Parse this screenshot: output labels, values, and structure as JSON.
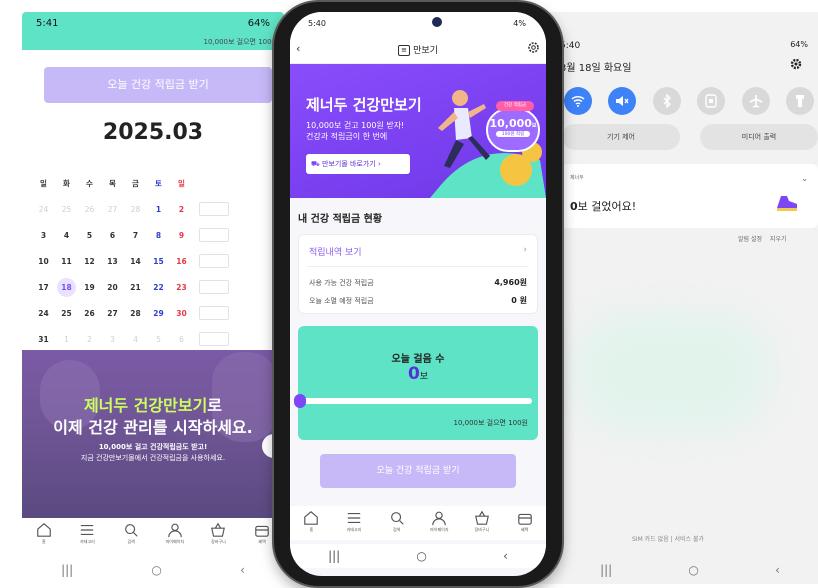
{
  "left": {
    "status_time": "5:41",
    "status_right": "64%",
    "banner_text": "10,000보 걸으면 100원",
    "redeem_label": "오늘 건강 적립금 받기",
    "month": "2025.03",
    "weekdays": [
      "일",
      "화",
      "수",
      "목",
      "금",
      "토",
      "일"
    ],
    "weeks": [
      [
        "24",
        "25",
        "26",
        "27",
        "28",
        "1",
        "2"
      ],
      [
        "3",
        "4",
        "5",
        "6",
        "7",
        "8",
        "9"
      ],
      [
        "10",
        "11",
        "12",
        "13",
        "14",
        "15",
        "16"
      ],
      [
        "17",
        "18",
        "19",
        "20",
        "21",
        "22",
        "23"
      ],
      [
        "24",
        "25",
        "26",
        "27",
        "28",
        "29",
        "30"
      ],
      [
        "31",
        "1",
        "2",
        "3",
        "4",
        "5",
        "6"
      ]
    ],
    "promo_title_accent": "제너두 건강만보기",
    "promo_title_rest": "로",
    "promo_title_line2": "이제 건강 관리를 시작하세요.",
    "promo_sub1": "10,000보 걸고 건강적립금도 받고!",
    "promo_sub2": "지금 건강만보기몰에서 건강적립금을 사용하세요.",
    "promo_button": "›",
    "nav": [
      {
        "icon": "home-icon",
        "label": "홈"
      },
      {
        "icon": "menu-icon",
        "label": "카테고리"
      },
      {
        "icon": "search-icon",
        "label": "검색"
      },
      {
        "icon": "person-icon",
        "label": "마이페이지"
      },
      {
        "icon": "basket-icon",
        "label": "장바구니"
      },
      {
        "icon": "box-icon",
        "label": "혜택"
      }
    ],
    "sys": [
      "|||",
      "○",
      "‹"
    ]
  },
  "phone": {
    "status_time": "5:40",
    "status_right": "4%",
    "header_title": "만보기",
    "hero_title": "제너두 건강만보기",
    "hero_sub1": "10,000보 걷고 100원 받자!",
    "hero_sub2": "건강과 적립금이 한 번에",
    "hero_button": "만보기몰 바로가기 ›",
    "badge_top": "건강 적립금",
    "badge_steps": "10,000",
    "badge_unit": "보",
    "badge_reward": "100원 적립",
    "section_title": "내 건강 적립금 현황",
    "history_link": "적립내역 보기",
    "available_label": "사용 가능 건강 적립금",
    "available_value": "4,960원",
    "expiring_label": "오늘 소멸 예정 적립금",
    "expiring_value": "0 원",
    "steps_label": "오늘 걸음 수",
    "steps_value": "0",
    "steps_unit": "보",
    "steps_progress": 0.0,
    "steps_footer": "10,000보 걸으면 100원",
    "redeem_label": "오늘 건강 적립금 받기",
    "nav": [
      {
        "icon": "home-icon",
        "label": "홈"
      },
      {
        "icon": "menu-icon",
        "label": "카테고리"
      },
      {
        "icon": "search-icon",
        "label": "검색"
      },
      {
        "icon": "person-icon",
        "label": "마이페이지"
      },
      {
        "icon": "basket-icon",
        "label": "장바구니"
      },
      {
        "icon": "box-icon",
        "label": "혜택"
      }
    ],
    "sys": [
      "|||",
      "○",
      "‹"
    ]
  },
  "right": {
    "status_time": "5:40",
    "status_right": "64%",
    "date": "3월 18일 화요일",
    "device_control": "기기 제어",
    "media_output": "미디어 출력",
    "notif_app": "제너두",
    "notif_count": "0",
    "notif_text": "보 걸었어요!",
    "notif_settings": "알림 설정",
    "notif_clear": "지우기",
    "sim_text": "SIM 카드 없음 | 서비스 불가",
    "sys": [
      "|||",
      "○",
      "‹"
    ]
  },
  "colors": {
    "purple": "#7d47f5",
    "mint": "#5fe3c6",
    "lavender": "#c7b9f8",
    "blue_toggle": "#3d82f7"
  }
}
